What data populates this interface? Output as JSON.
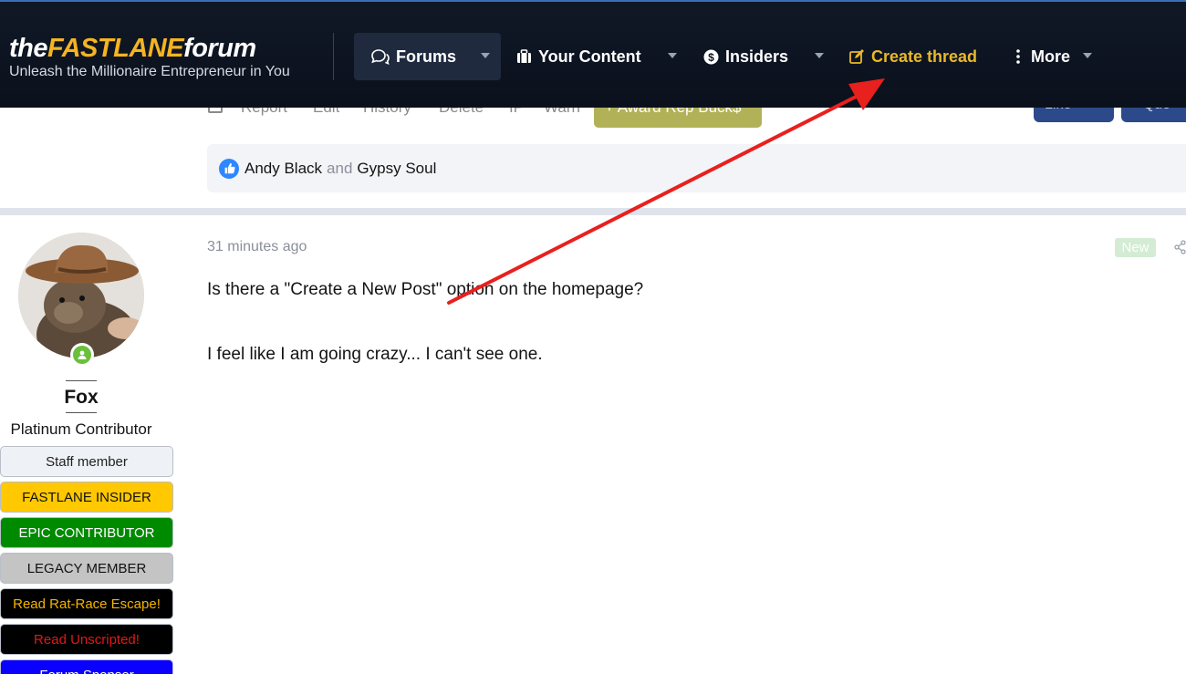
{
  "site": {
    "logo_the": "the",
    "logo_fastlane": "FASTLANE",
    "logo_forum": "forum",
    "tagline": "Unleash the Millionaire Entrepreneur in You"
  },
  "nav": {
    "forums": "Forums",
    "your_content": "Your Content",
    "insiders": "Insiders",
    "create_thread": "Create thread",
    "more": "More"
  },
  "prev_post": {
    "actions": [
      "Report",
      "Edit",
      "History",
      "Delete",
      "IP",
      "Warn"
    ],
    "award": "+ Award Rep Buck$",
    "like": "Like",
    "quote": "+ Quo",
    "reaction_user1": "Andy Black",
    "reaction_and": "and",
    "reaction_user2": "Gypsy Soul"
  },
  "user": {
    "name": "Fox",
    "title": "Platinum Contributor",
    "banners": [
      {
        "label": "Staff member",
        "bg": "#eef1f6",
        "fg": "#222222"
      },
      {
        "label": "FASTLANE INSIDER",
        "bg": "#ffc800",
        "fg": "#111111"
      },
      {
        "label": "EPIC CONTRIBUTOR",
        "bg": "#008a00",
        "fg": "#ffffff"
      },
      {
        "label": "LEGACY MEMBER",
        "bg": "#c4c4c4",
        "fg": "#111111"
      },
      {
        "label": "Read Rat-Race Escape!",
        "bg": "#000000",
        "fg": "#f6b400"
      },
      {
        "label": "Read Unscripted!",
        "bg": "#000000",
        "fg": "#e01818"
      },
      {
        "label": "Forum Sponsor",
        "bg": "#0a00ff",
        "fg": "#ffffff"
      }
    ]
  },
  "post": {
    "time": "31 minutes ago",
    "badge": "New",
    "line1": "Is there a \"Create a New Post\" option on the homepage?",
    "line2": "I feel like I am going crazy... I can't see one."
  },
  "colors": {
    "accent": "#e9b82a",
    "annotation_arrow": "#e8201e"
  }
}
